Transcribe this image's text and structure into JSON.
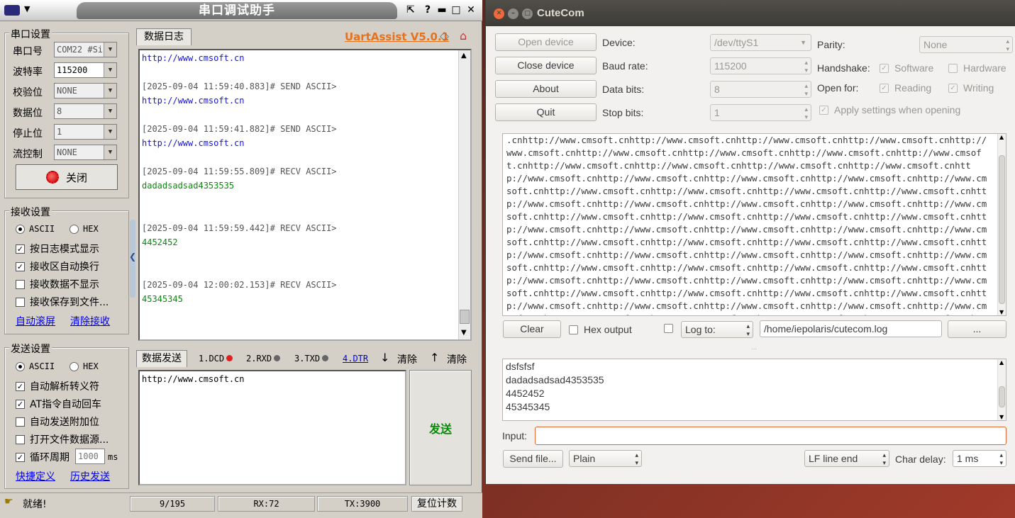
{
  "uart": {
    "title": "串口调试助手",
    "version": "UartAssist V5.0.1",
    "serial": {
      "group": "串口设置",
      "port_label": "串口号",
      "port_value": "COM22 #Si",
      "baud_label": "波特率",
      "baud_value": "115200",
      "parity_label": "校验位",
      "parity_value": "NONE",
      "data_label": "数据位",
      "data_value": "8",
      "stop_label": "停止位",
      "stop_value": "1",
      "flow_label": "流控制",
      "flow_value": "NONE",
      "close_label": "关闭"
    },
    "recv": {
      "group": "接收设置",
      "ascii": "ASCII",
      "hex": "HEX",
      "opt1": "按日志模式显示",
      "opt2": "接收区自动换行",
      "opt3": "接收数据不显示",
      "opt4": "接收保存到文件...",
      "link1": "自动滚屏",
      "link2": "清除接收"
    },
    "send": {
      "group": "发送设置",
      "ascii": "ASCII",
      "hex": "HEX",
      "opt1": "自动解析转义符",
      "opt2": "AT指令自动回车",
      "opt3": "自动发送附加位",
      "opt4": "打开文件数据源...",
      "opt5": "循环周期",
      "period": "1000",
      "period_unit": "ms",
      "link1": "快捷定义",
      "link2": "历史发送"
    },
    "log_tab": "数据日志",
    "log": [
      {
        "text": "http://www.cmsoft.cn",
        "kind": "blue"
      },
      {
        "text": "[2025-09-04 11:59:40.883]# SEND ASCII>",
        "kind": "gray"
      },
      {
        "text": "http://www.cmsoft.cn",
        "kind": "blue"
      },
      {
        "text": "[2025-09-04 11:59:41.882]# SEND ASCII>",
        "kind": "gray"
      },
      {
        "text": "http://www.cmsoft.cn",
        "kind": "blue"
      },
      {
        "text": "[2025-09-04 11:59:55.809]# RECV ASCII>",
        "kind": "gray"
      },
      {
        "text": "dadadsadsad4353535",
        "kind": "green"
      },
      {
        "text": "[2025-09-04 11:59:59.442]# RECV ASCII>",
        "kind": "gray"
      },
      {
        "text": "4452452",
        "kind": "green"
      },
      {
        "text": "[2025-09-04 12:00:02.153]# RECV ASCII>",
        "kind": "gray"
      },
      {
        "text": "45345345",
        "kind": "green"
      }
    ],
    "send_tab": "数据发送",
    "signals": {
      "dcd": "1.DCD",
      "rxd": "2.RXD",
      "txd": "3.TXD",
      "dtr": "4.DTR"
    },
    "clear1": "清除",
    "clear2": "清除",
    "send_text": "http://www.cmsoft.cn",
    "send_button": "发送",
    "status": {
      "ready": "就绪!",
      "progress": "9/195",
      "rx": "RX:72",
      "tx": "TX:3900",
      "reset": "复位计数"
    }
  },
  "cutecom": {
    "title": "CuteCom",
    "buttons": {
      "open": "Open device",
      "close": "Close device",
      "about": "About",
      "quit": "Quit"
    },
    "device_label": "Device:",
    "device_value": "/dev/ttyS1",
    "baud_label": "Baud rate:",
    "baud_value": "115200",
    "databits_label": "Data bits:",
    "databits_value": "8",
    "stopbits_label": "Stop bits:",
    "stopbits_value": "1",
    "parity_label": "Parity:",
    "parity_value": "None",
    "handshake_label": "Handshake:",
    "software": "Software",
    "hardware": "Hardware",
    "openfor_label": "Open for:",
    "reading": "Reading",
    "writing": "Writing",
    "apply": "Apply settings when opening",
    "output_text": ".cnhttp://www.cmsoft.cnhttp://www.cmsoft.cnhttp://www.cmsoft.cnhttp://www.cmsoft.cnhttp://www.cmsoft.cnhttp://www.cmsoft.cnhttp://www.cmsoft.cnhttp://www.cmsoft.cnhttp://www.cmsoft.cnhttp://www.cmsoft.cnhttp://www.cmsoft.cnhttp://www.cmsoft.cnhttp://www.cmsoft.cnhttp://www.cmsoft.cnhttp://www.cmsoft.cnhttp://www.cmsoft.cnhttp://www.cmsoft.cnhttp://www.cmsoft.cnhttp://www.cmsoft.cnhttp://www.cmsoft.cnhttp://www.cmsoft.cnhttp://www.cmsoft.cnhttp://www.cmsoft.cnhttp://www.cmsoft.cnhttp://www.cmsoft.cnhttp://www.cmsoft.cnhttp://www.cmsoft.cnhttp://www.cmsoft.cnhttp://www.cmsoft.cnhttp://www.cmsoft.cnhttp://www.cmsoft.cnhttp://www.cmsoft.cnhttp://www.cmsoft.cnhttp://www.cmsoft.cnhttp://www.cmsoft.cnhttp://www.cmsoft.cnhttp://www.cmsoft.cnhttp://www.cmsoft.cnhttp://www.cmsoft.cnhttp://www.cmsoft.cnhttp://www.cmsoft.cnhttp://www.cmsoft.cnhttp://www.cmsoft.cnhttp://www.cmsoft.cnhttp://www.cmsoft.cnhttp://www.cmsoft.cnhttp://www.cmsoft.cnhttp://www.cmsoft.cnhttp://www.cmsoft.cnhttp://www.cmsoft.cnhttp://www.cmsoft.cnhttp://www.cmsoft.cnhttp://www.cmsoft.cnhttp://www.cmsoft.cnhttp://www.cmsoft.cnhttp://www.cmsoft.cnhttp://www.cmsoft.cnhttp://www.cmsoft.cnhttp://www.cmsoft.cnhttp://www.cmsoft.cnhttp://www.cmsoft.cnhttp://www.cmsoft.cnhttp://www.cmsoft.cnhttp://www.cmsoft.cnhttp://www.cmsoft.cnhttp://www.cmsoft.cnhttp://www.cmsoft.cnhttp://www.cmsoft.cnhttp://www.cmsoft.cnhttp://www.cmsoft.cnhttp://www.cmsoft.cnhttp://www.cmsoft.cnhttp://www.cmsoft.cnhttp://www.cmsoft.cn",
    "clear": "Clear",
    "hex_output": "Hex output",
    "logto": "Log to:",
    "logfile": "/home/iepolaris/cutecom.log",
    "browse": "...",
    "received": [
      "dsfsfsf",
      "dadadsadsad4353535",
      "4452452",
      "45345345"
    ],
    "input_label": "Input:",
    "sendfile": "Send file...",
    "format": "Plain",
    "lineend": "LF line end",
    "chardelay_label": "Char delay:",
    "chardelay_value": "1 ms"
  },
  "colors": {
    "uart_link": "#0000ee",
    "uart_version": "#e8711c",
    "recv_green": "#0a8a0a",
    "cutecom_input_border": "#e2672e"
  }
}
